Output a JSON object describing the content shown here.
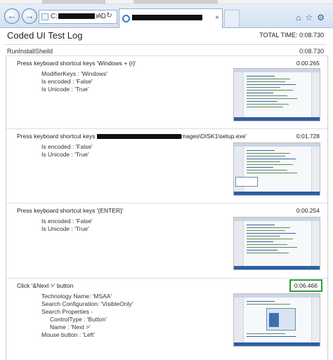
{
  "browser": {
    "address_prefix": "C:",
    "address_suffix": "x\\D",
    "address_tools": "⌕ ↻",
    "tab_close": "×"
  },
  "icons": {
    "back": "back-arrow-icon",
    "forward": "forward-arrow-icon",
    "home": "home-icon",
    "favorites": "star-icon",
    "settings": "gear-icon"
  },
  "report": {
    "title": "Coded UI Test Log",
    "total_time": "TOTAL TIME: 0:08.730",
    "test_name": "RunInstallSheild",
    "test_time": "0:08.730"
  },
  "steps": [
    {
      "title": "Press keyboard shortcut keys 'Windows + {r}'",
      "time": "0:00.265",
      "props": [
        "ModifierKeys : 'Windows'",
        "Is encoded : 'False'",
        "Is Unicode : 'True'"
      ]
    },
    {
      "title_prefix": "Press keyboard shortcut keys",
      "title_suffix": "mages\\DISK1\\setup.exe'",
      "time": "0:01.728",
      "props": [
        "Is encoded : 'False'",
        "Is Unicode : 'True'"
      ]
    },
    {
      "title": "Press keyboard shortcut keys '{ENTER}'",
      "time": "0:00.254",
      "props": [
        "Is encoded : 'False'",
        "Is Unicode : 'True'"
      ]
    },
    {
      "title": "Click '&Next >' button",
      "time": "0:06.466",
      "props": [
        "Technology Name: 'MSAA'",
        "Search Configuration: 'VisibleOnly'",
        "Search Properties -",
        "ControlType : 'Button'",
        "Name : 'Next >'",
        "Mouse button : 'Left'"
      ]
    }
  ],
  "colors": {
    "highlight_border": "#2e9e3c",
    "chrome_bg": "#d4e1f1"
  }
}
